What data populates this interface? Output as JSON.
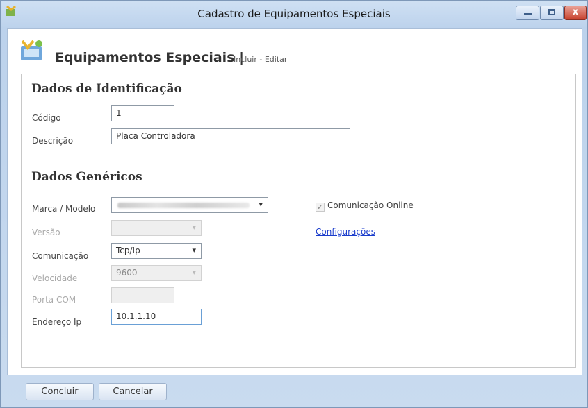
{
  "window": {
    "title": "Cadastro de Equipamentos Especiais",
    "close_glyph": "x"
  },
  "header": {
    "title": "Equipamentos Especiais |",
    "subtitle": "Incluir - Editar"
  },
  "identificacao": {
    "section_title": "Dados de Identificação",
    "codigo_label": "Código",
    "codigo_value": "1",
    "descricao_label": "Descrição",
    "descricao_value": "Placa Controladora"
  },
  "genericos": {
    "section_title": "Dados Genéricos",
    "marca_label": "Marca / Modelo",
    "versao_label": "Versão",
    "comunicacao_label": "Comunicação",
    "comunicacao_value": "Tcp/Ip",
    "velocidade_label": "Velocidade",
    "velocidade_value": "9600",
    "porta_label": "Porta COM",
    "endereco_label": "Endereço Ip",
    "endereco_value": "10.1.1.10",
    "online_label": "Comunicação Online",
    "online_checked": true,
    "config_link": "Configurações"
  },
  "footer": {
    "concluir": "Concluir",
    "cancelar": "Cancelar"
  },
  "icons": {
    "caret": "▾",
    "check": "✓"
  },
  "colors": {
    "link": "#1a3ccc",
    "close_button": "#c7412d"
  }
}
